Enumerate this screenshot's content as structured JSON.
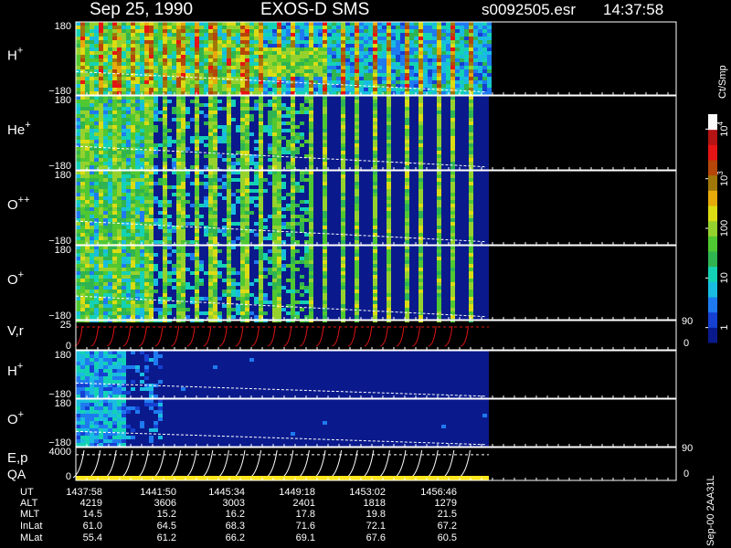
{
  "header": {
    "date": "Sep 25, 1990",
    "mission": "EXOS-D SMS",
    "file": "s0092505.esr",
    "time": "14:37:58"
  },
  "colorbar": {
    "unit_label": "Ct/Smp",
    "scale": "log",
    "range": [
      0.5,
      20000
    ],
    "ticks": [
      {
        "label": "1",
        "value": 1
      },
      {
        "label": "10",
        "value": 10
      },
      {
        "label": "100",
        "value": 100
      },
      {
        "label": "10",
        "sup": "3",
        "value": 1000
      },
      {
        "label": "10",
        "sup": "4",
        "value": 10000
      }
    ],
    "colors": [
      "#0a1a8c",
      "#1540d2",
      "#1f7af0",
      "#19bce0",
      "#14d2b4",
      "#2fb451",
      "#50c832",
      "#96d22d",
      "#dcdc14",
      "#e6aa0a",
      "#a0780a",
      "#b4460a",
      "#e61414",
      "#b41414",
      "#fafafa"
    ]
  },
  "footer": {
    "version": "Sep-00 2AA31L",
    "rows": [
      {
        "label": "UT",
        "values": [
          "1437:58",
          "1441:50",
          "1445:34",
          "1449:18",
          "1453:02",
          "1456:46"
        ]
      },
      {
        "label": "ALT",
        "values": [
          "4219",
          "3606",
          "3003",
          "2401",
          "1818",
          "1279"
        ]
      },
      {
        "label": "MLT",
        "values": [
          "14.5",
          "15.2",
          "16.2",
          "17.8",
          "19.8",
          "21.5"
        ]
      },
      {
        "label": "InLat",
        "values": [
          "61.0",
          "64.5",
          "68.3",
          "71.6",
          "72.1",
          "67.2"
        ]
      },
      {
        "label": "MLat",
        "values": [
          "55.4",
          "61.2",
          "66.2",
          "69.1",
          "67.6",
          "60.5"
        ]
      }
    ]
  },
  "chart_data": [
    {
      "type": "heatmap",
      "name": "H",
      "sup": "+",
      "yticks": [
        "180",
        "−180"
      ],
      "ylim": [
        -180,
        180
      ],
      "pattern": "dense"
    },
    {
      "type": "heatmap",
      "name": "He",
      "sup": "+",
      "yticks": [
        "180",
        "−180"
      ],
      "ylim": [
        -180,
        180
      ],
      "pattern": "stripes"
    },
    {
      "type": "heatmap",
      "name": "O",
      "sup": "++",
      "yticks": [
        "180",
        "−180"
      ],
      "ylim": [
        -180,
        180
      ],
      "pattern": "stripes"
    },
    {
      "type": "heatmap",
      "name": "O",
      "sup": "+",
      "yticks": [
        "180",
        "−180"
      ],
      "ylim": [
        -180,
        180
      ],
      "pattern": "stripes"
    },
    {
      "type": "line",
      "name": "V,r",
      "yticks": [
        "25",
        "0"
      ],
      "right_ticks": [
        "90",
        "0"
      ]
    },
    {
      "type": "heatmap",
      "name": "H",
      "sup": "+",
      "yticks": [
        "180",
        "−180"
      ],
      "ylim": [
        -180,
        180
      ],
      "pattern": "sparse"
    },
    {
      "type": "heatmap",
      "name": "O",
      "sup": "+",
      "yticks": [
        "180",
        "−180"
      ],
      "ylim": [
        -180,
        180
      ],
      "pattern": "sparse"
    },
    {
      "type": "line",
      "name": "E,p",
      "name2": "QA",
      "yticks": [
        "4000",
        "0"
      ],
      "right_ticks": [
        "90",
        "0"
      ]
    }
  ]
}
